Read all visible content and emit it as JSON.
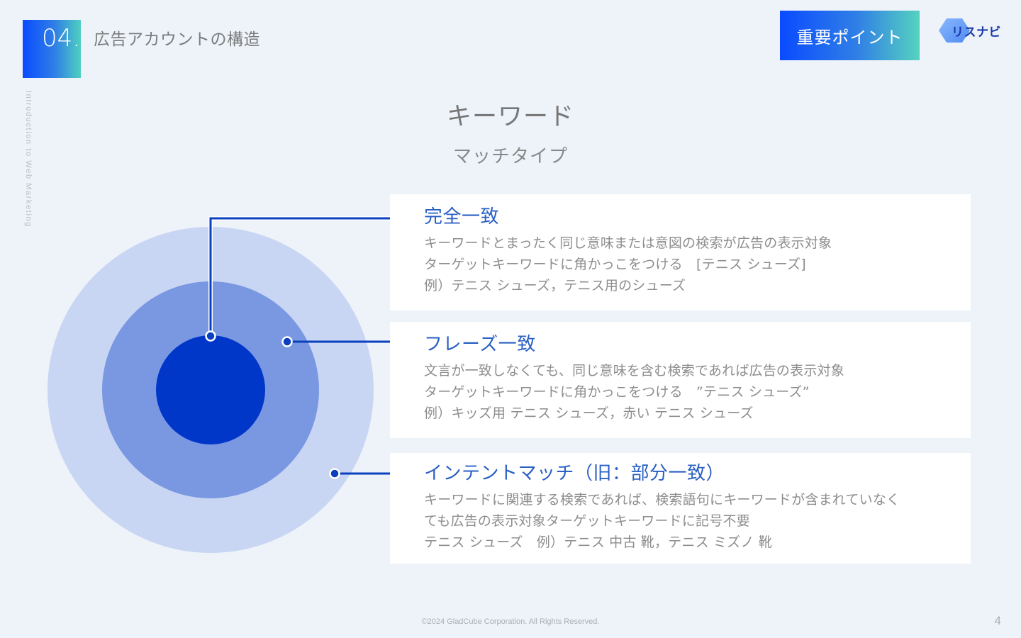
{
  "header": {
    "section_number": "04.",
    "section_title": "広告アカウントの構造",
    "vertical_caption": "Introduction to Web Marketing",
    "badge_label": "重要ポイント",
    "logo_text": "リスナビ"
  },
  "main": {
    "heading": "キーワード",
    "subheading": "マッチタイプ",
    "match_types": [
      {
        "title": "完全一致",
        "lines": [
          "キーワードとまったく同じ意味または意図の検索が広告の表示対象",
          "ターゲットキーワードに角かっこをつける　[テニス シューズ]",
          "例）テニス シューズ，テニス用のシューズ"
        ]
      },
      {
        "title": "フレーズ一致",
        "lines": [
          "文言が一致しなくても、同じ意味を含む検索であれば広告の表示対象",
          "ターゲットキーワードに角かっこをつける　”テニス シューズ”",
          "例）キッズ用 テニス シューズ，赤い テニス シューズ"
        ]
      },
      {
        "title": "インテントマッチ（旧：部分一致）",
        "lines": [
          "キーワードに関連する検索であれば、検索語句にキーワードが含まれていなく",
          "ても広告の表示対象ターゲットキーワードに記号不要",
          "テニス シューズ　例）テニス 中古 靴，テニス ミズノ 靴"
        ]
      }
    ]
  },
  "footer": {
    "copyright": "©2024 GladCube Corporation. All Rights Reserved.",
    "page_number": "4"
  },
  "colors": {
    "outer_circle": "#c8d6f3",
    "middle_circle": "#7a98e2",
    "inner_circle": "#0037c8",
    "connector": "#0a3fbf",
    "accent_title": "#2a5fc4"
  }
}
